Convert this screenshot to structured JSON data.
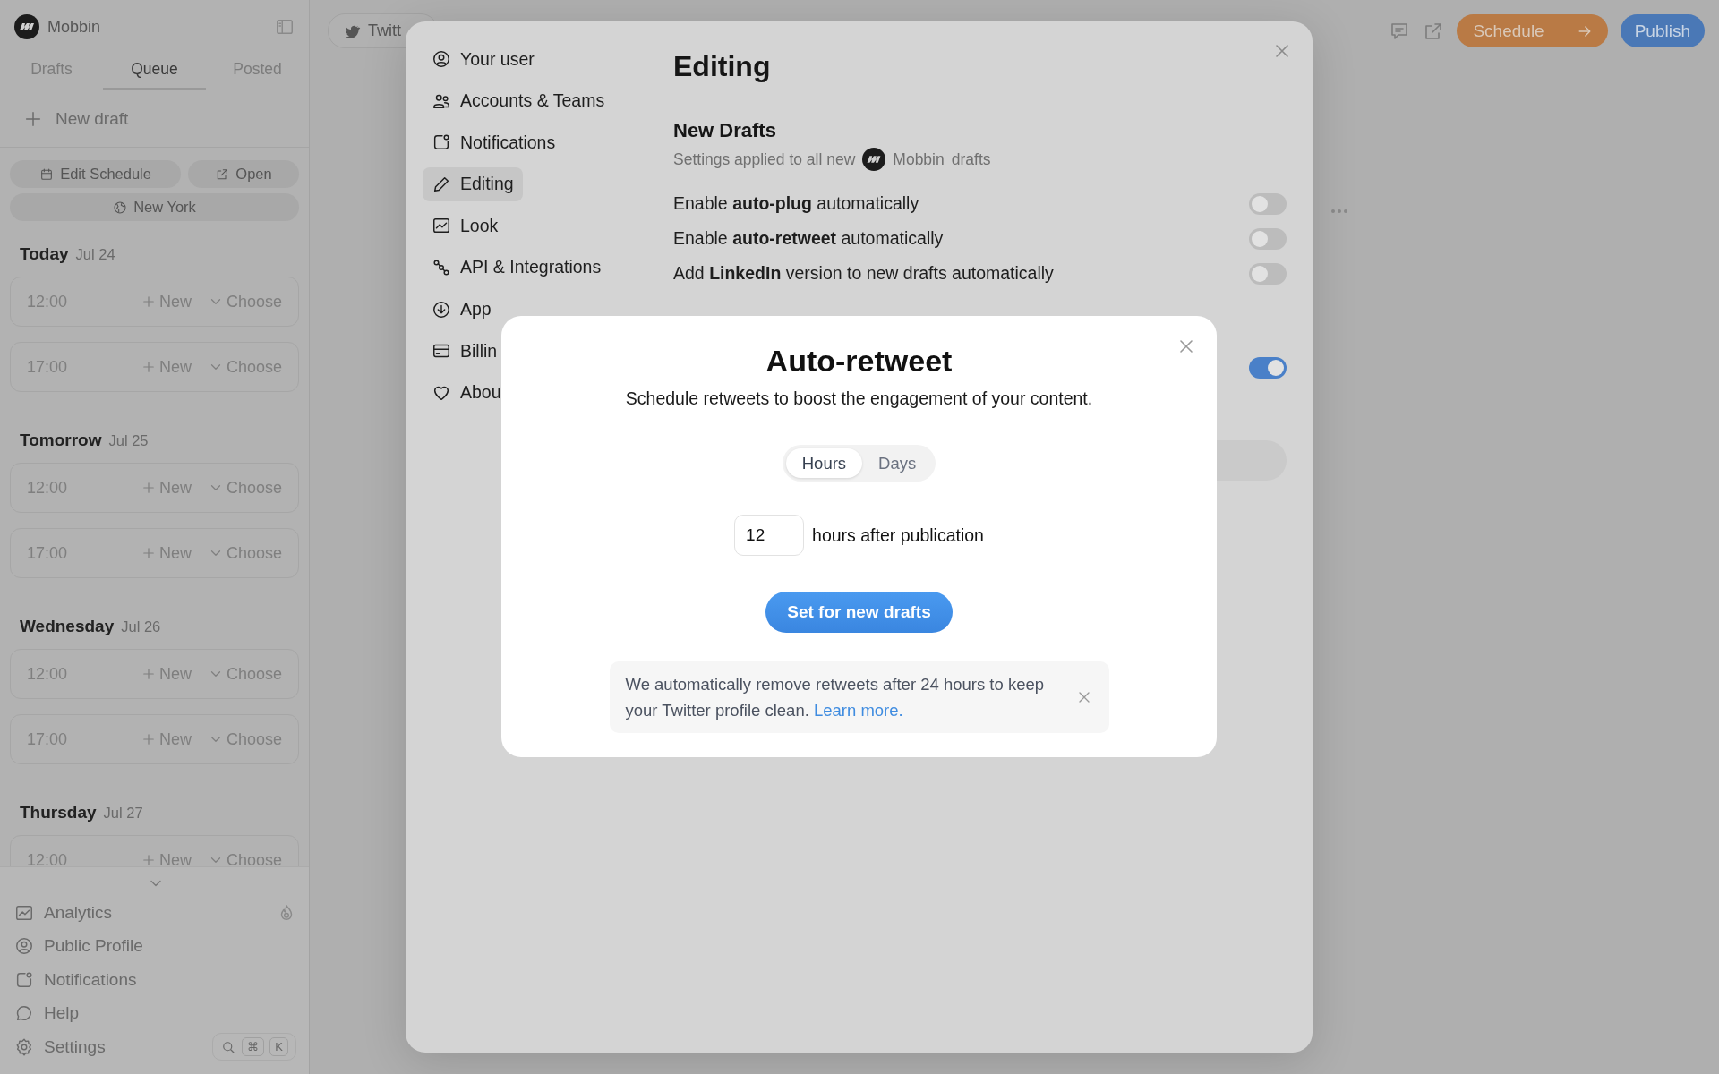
{
  "sidebar": {
    "brand": "Mobbin",
    "tabs": [
      {
        "label": "Drafts",
        "selected": false
      },
      {
        "label": "Queue",
        "selected": true
      },
      {
        "label": "Posted",
        "selected": false
      }
    ],
    "new_draft": "New draft",
    "edit_schedule": "Edit Schedule",
    "open": "Open",
    "timezone": "New York",
    "days": [
      {
        "day": "Today",
        "date": "Jul 24",
        "slots": [
          {
            "time": "12:00",
            "new": "New",
            "choose": "Choose"
          },
          {
            "time": "17:00",
            "new": "New",
            "choose": "Choose"
          }
        ]
      },
      {
        "day": "Tomorrow",
        "date": "Jul 25",
        "slots": [
          {
            "time": "12:00",
            "new": "New",
            "choose": "Choose"
          },
          {
            "time": "17:00",
            "new": "New",
            "choose": "Choose"
          }
        ]
      },
      {
        "day": "Wednesday",
        "date": "Jul 26",
        "slots": [
          {
            "time": "12:00",
            "new": "New",
            "choose": "Choose"
          },
          {
            "time": "17:00",
            "new": "New",
            "choose": "Choose"
          }
        ]
      },
      {
        "day": "Thursday",
        "date": "Jul 27",
        "slots": [
          {
            "time": "12:00",
            "new": "New",
            "choose": "Choose"
          }
        ]
      }
    ],
    "nav": [
      {
        "label": "Analytics",
        "kind": "analytics"
      },
      {
        "label": "Public Profile",
        "kind": "profile"
      },
      {
        "label": "Notifications",
        "kind": "notifications"
      },
      {
        "label": "Help",
        "kind": "help"
      },
      {
        "label": "Settings",
        "kind": "settings"
      }
    ],
    "shortcut_keys": [
      "⌘",
      "K"
    ]
  },
  "topbar": {
    "account_tab": "Twitt",
    "schedule": "Schedule",
    "publish": "Publish"
  },
  "settings": {
    "nav": [
      {
        "label": "Your user",
        "kind": "user",
        "selected": false
      },
      {
        "label": "Accounts & Teams",
        "kind": "team",
        "selected": false
      },
      {
        "label": "Notifications",
        "kind": "notifications",
        "selected": false
      },
      {
        "label": "Editing",
        "kind": "pencil",
        "selected": true
      },
      {
        "label": "Look",
        "kind": "chart",
        "selected": false
      },
      {
        "label": "API & Integrations",
        "kind": "api",
        "selected": false
      },
      {
        "label": "App",
        "kind": "download",
        "selected": false
      },
      {
        "label": "Billin",
        "kind": "card",
        "selected": false
      },
      {
        "label": "Abou",
        "kind": "heart",
        "selected": false
      }
    ],
    "title": "Editing",
    "section": "New Drafts",
    "subtitle": "Settings applied to all new",
    "account": "Mobbin",
    "subtitle_end": "drafts",
    "options": [
      {
        "text": "Enable **auto-plug** automatically",
        "on": false
      },
      {
        "text": "Enable **auto-retweet** automatically",
        "on": false
      },
      {
        "text": "Add **LinkedIn** version to new drafts automatically",
        "on": false
      }
    ],
    "extra_toggle": {
      "on": true
    }
  },
  "dialog": {
    "title": "Auto-retweet",
    "description": "Schedule retweets to boost the engagement of your content.",
    "units": [
      {
        "label": "Hours",
        "selected": true
      },
      {
        "label": "Days",
        "selected": false
      }
    ],
    "value": "12",
    "suffix": "hours after publication",
    "button": "Set for new drafts",
    "note": "We automatically remove retweets after 24 hours to keep your Twitter profile clean.",
    "link": "Learn more."
  }
}
